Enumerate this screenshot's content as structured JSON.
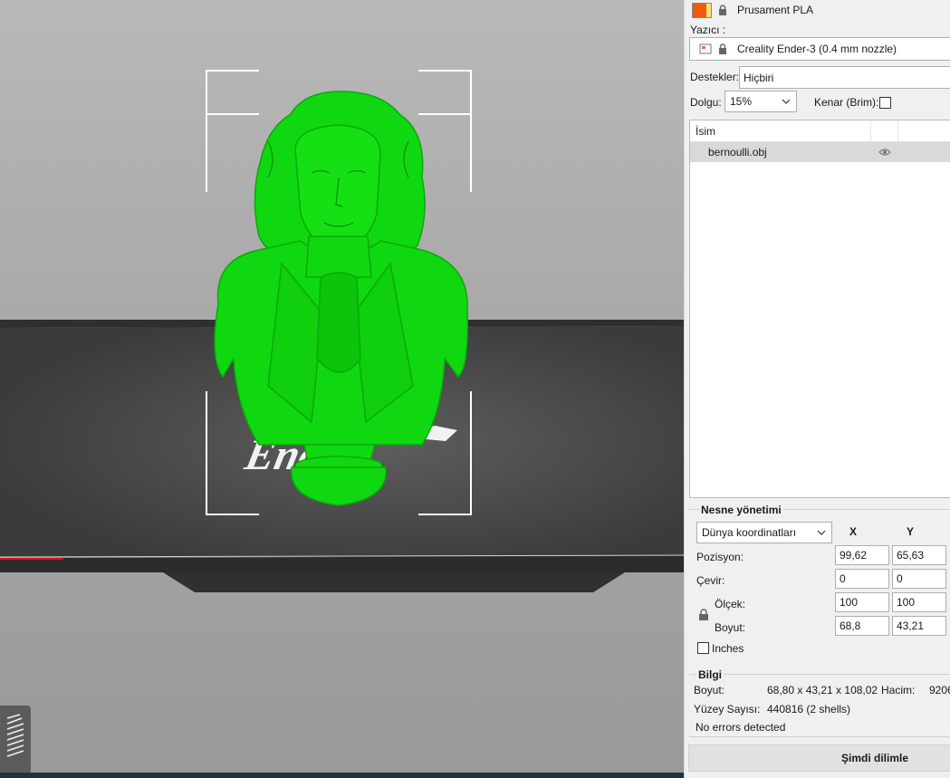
{
  "filament": {
    "name": "Prusament PLA",
    "colors": [
      "#f05a0a",
      "#f6e080"
    ]
  },
  "printer": {
    "label": "Yazıcı :",
    "name": "Creality Ender-3 (0.4 mm nozzle)"
  },
  "supports": {
    "label": "Destekler:",
    "value": "Hiçbiri"
  },
  "infill": {
    "label": "Dolgu:",
    "value": "15%"
  },
  "brim": {
    "label": "Kenar (Brim):",
    "checked": false
  },
  "object_list": {
    "header": "İsim",
    "items": [
      {
        "name": "bernoulli.obj",
        "visible": true
      }
    ]
  },
  "object_manipulation": {
    "title": "Nesne yönetimi",
    "coord_system": "Dünya koordinatları",
    "axis_x": "X",
    "axis_y": "Y",
    "position": {
      "label": "Pozisyon:",
      "x": "99,62",
      "y": "65,63"
    },
    "rotation": {
      "label": "Çevir:",
      "x": "0",
      "y": "0"
    },
    "scale": {
      "label": "Ölçek:",
      "x": "100",
      "y": "100"
    },
    "size": {
      "label": "Boyut:",
      "x": "68,8",
      "y": "43,21"
    },
    "inches": {
      "label": "Inches",
      "checked": false
    }
  },
  "info": {
    "title": "Bilgi",
    "size_label": "Boyut:",
    "size_value": "68,80 x 43,21 x 108,02",
    "volume_label": "Hacim:",
    "volume_value": "9206",
    "facets_label": "Yüzey Sayısı:",
    "facets_value": "440816 (2 shells)",
    "errors": "No errors detected"
  },
  "slice_button": "Şimdi dilimle",
  "viewport": {
    "bed_logo_text": "Ender",
    "model_color": "#00e000"
  }
}
